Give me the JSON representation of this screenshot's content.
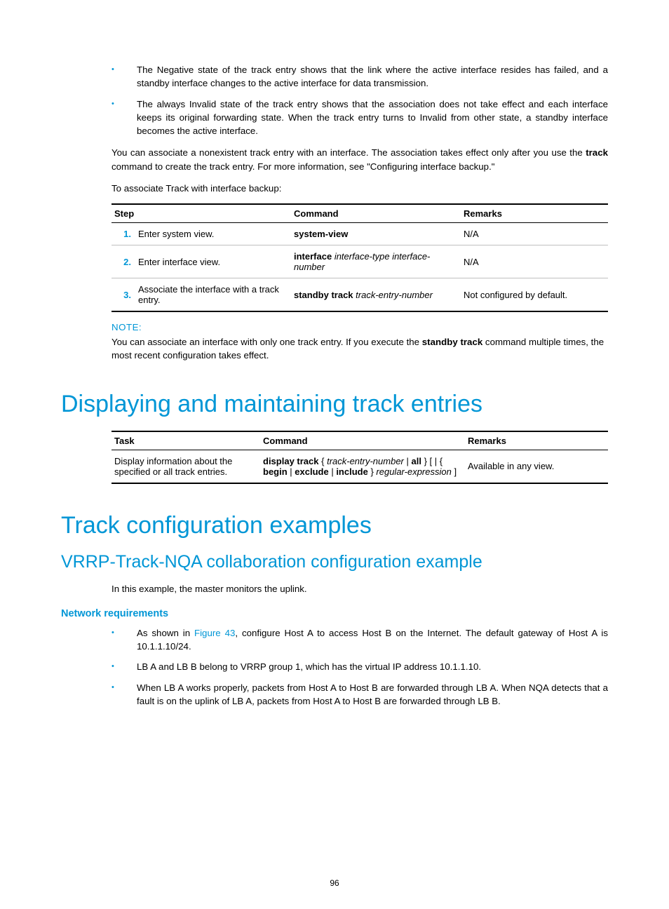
{
  "bullets_top": [
    "The Negative state of the track entry shows that the link where the active interface resides has failed, and a standby interface changes to the active interface for data transmission.",
    "The always Invalid state of the track entry shows that the association does not take effect and each interface keeps its original forwarding state. When the track entry turns to Invalid from other state, a standby interface becomes the active interface."
  ],
  "para1_pre": "You can associate a nonexistent track entry with an interface. The association takes effect only after you use the ",
  "para1_bold": "track",
  "para1_post": " command to create the track entry. For more information, see \"Configuring interface backup.\"",
  "para2": "To associate Track with interface backup:",
  "table1": {
    "headers": [
      "Step",
      "Command",
      "Remarks"
    ],
    "rows": [
      {
        "num": "1.",
        "step": "Enter system view.",
        "cmd_bold": "system-view",
        "cmd_italic": "",
        "remark": "N/A"
      },
      {
        "num": "2.",
        "step": "Enter interface view.",
        "cmd_bold": "interface",
        "cmd_italic": " interface-type interface-number",
        "remark": "N/A"
      },
      {
        "num": "3.",
        "step": "Associate the interface with a track entry.",
        "cmd_bold": "standby track",
        "cmd_italic": " track-entry-number",
        "remark": "Not configured by default."
      }
    ]
  },
  "note": {
    "label": "NOTE:",
    "pre": "You can associate an interface with only one track entry. If you execute the ",
    "bold": "standby track",
    "post": " command multiple times, the most recent configuration takes effect."
  },
  "h1a": "Displaying and maintaining track entries",
  "table2": {
    "headers": [
      "Task",
      "Command",
      "Remarks"
    ],
    "row": {
      "task": "Display information about the specified or all track entries.",
      "cmd_parts": {
        "b1": "display track",
        "t1": " { ",
        "i1": "track-entry-number",
        "t2": " | ",
        "b2": "all",
        "t3": " } [ | { ",
        "b3": "begin",
        "t4": " | ",
        "b4": "exclude",
        "t5": " | ",
        "b5": "include",
        "t6": " } ",
        "i2": "regular-expression",
        "t7": " ]"
      },
      "remark": "Available in any view."
    }
  },
  "h1b": "Track configuration examples",
  "h2a": "VRRP-Track-NQA collaboration configuration example",
  "para3": "In this example, the master monitors the uplink.",
  "h3a": "Network requirements",
  "bullets_bottom_0_pre": "As shown in ",
  "bullets_bottom_0_link": "Figure 43",
  "bullets_bottom_0_post": ", configure Host A to access Host B on the Internet. The default gateway of Host A is 10.1.1.10/24.",
  "bullets_bottom_1": "LB A and LB B belong to VRRP group 1, which has the virtual IP address 10.1.1.10.",
  "bullets_bottom_2": "When LB A works properly, packets from Host A to Host B are forwarded through LB A. When NQA detects that a fault is on the uplink of LB A, packets from Host A to Host B are forwarded through LB B.",
  "page_number": "96"
}
